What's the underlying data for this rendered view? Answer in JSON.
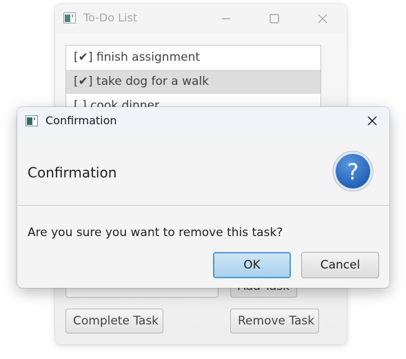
{
  "main_window": {
    "title": "To-Do List",
    "window_controls": {
      "minimize_icon": "minimize-icon",
      "maximize_icon": "maximize-icon",
      "close_icon": "close-icon"
    },
    "tasks": [
      {
        "label": "[✔] finish assignment",
        "selected": false
      },
      {
        "label": "[✔] take dog for a walk",
        "selected": true
      },
      {
        "label": "[ ] cook dinner",
        "selected": false
      }
    ],
    "new_task_input": {
      "value": "",
      "placeholder": ""
    },
    "buttons": {
      "add": "Add Task",
      "complete": "Complete Task",
      "remove": "Remove Task"
    }
  },
  "dialog": {
    "title": "Confirmation",
    "header_text": "Confirmation",
    "icon": "question-icon",
    "message": "Are you sure you want to remove this task?",
    "buttons": {
      "ok": "OK",
      "cancel": "Cancel"
    }
  },
  "colors": {
    "ok_button_fill": "#a9d1ec",
    "ok_button_border": "#4d9ad6",
    "question_icon_fill": "#2d6fc4",
    "selected_row": "#d6d6d6"
  }
}
